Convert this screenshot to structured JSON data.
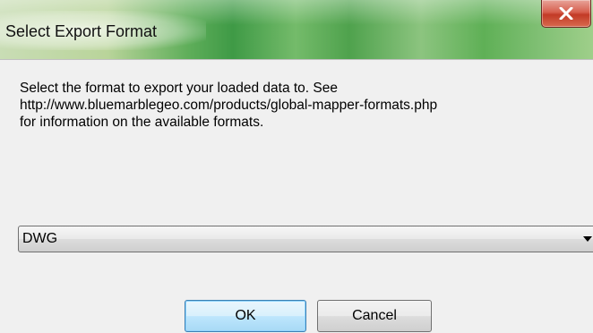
{
  "window": {
    "title": "Select Export Format",
    "close_icon": "close-icon"
  },
  "description": {
    "line1": "Select the format to export your loaded data to. See",
    "line2": "http://www.bluemarblegeo.com/products/global-mapper-formats.php",
    "line3": "for information on the available formats."
  },
  "format_select": {
    "selected": "DWG",
    "arrow_icon": "chevron-down-icon"
  },
  "buttons": {
    "ok_label": "OK",
    "cancel_label": "Cancel"
  },
  "colors": {
    "title_bar_accent": "#5fae5a",
    "close_button": "#c23a26",
    "default_button_border": "#3c7fb1"
  }
}
